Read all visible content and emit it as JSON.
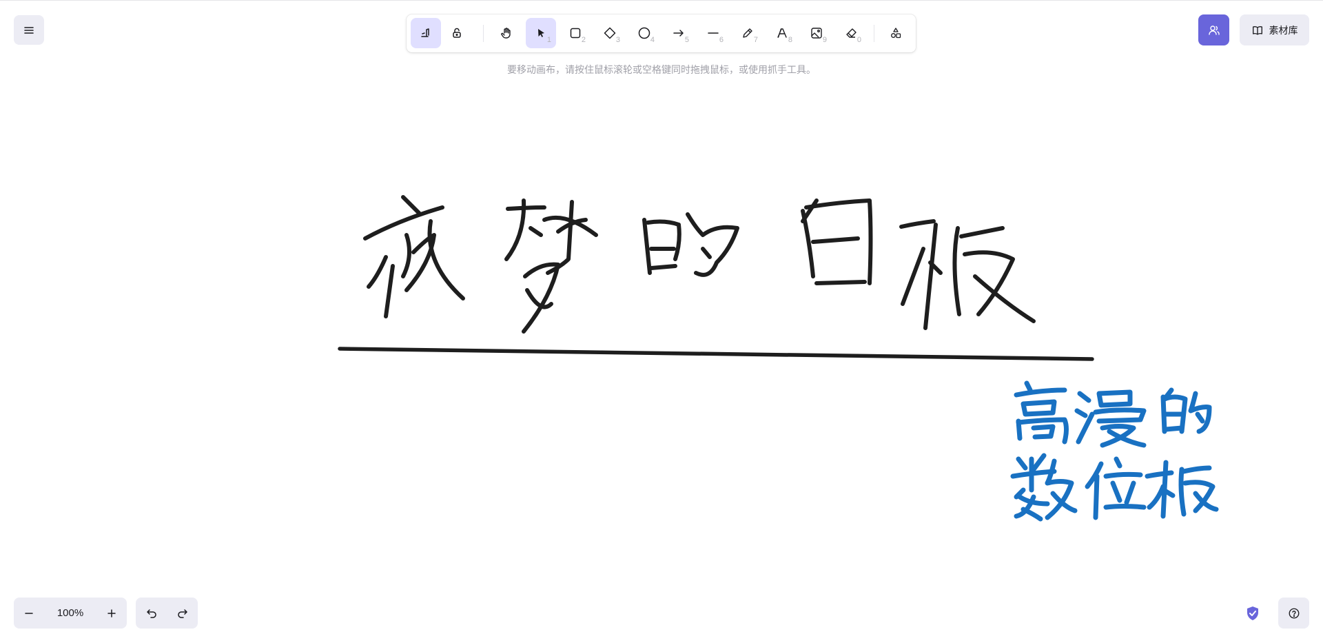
{
  "hint": "要移动画布，请按住鼠标滚轮或空格键同时拖拽鼠标，或使用抓手工具。",
  "toolbar": {
    "tools": [
      {
        "name": "pen-mode",
        "icon": "pen-mode-icon",
        "key": "",
        "active": true
      },
      {
        "name": "lock",
        "icon": "unlock-icon",
        "key": "",
        "active": false
      },
      {
        "name": "hand",
        "icon": "hand-icon",
        "key": "",
        "active": false
      },
      {
        "name": "selection",
        "icon": "pointer-icon",
        "key": "1",
        "active": true
      },
      {
        "name": "rectangle",
        "icon": "rectangle-icon",
        "key": "2",
        "active": false
      },
      {
        "name": "diamond",
        "icon": "diamond-icon",
        "key": "3",
        "active": false
      },
      {
        "name": "ellipse",
        "icon": "ellipse-icon",
        "key": "4",
        "active": false
      },
      {
        "name": "arrow",
        "icon": "arrow-icon",
        "key": "5",
        "active": false
      },
      {
        "name": "line",
        "icon": "line-icon",
        "key": "6",
        "active": false
      },
      {
        "name": "draw",
        "icon": "pencil-icon",
        "key": "7",
        "active": false
      },
      {
        "name": "text",
        "icon": "text-icon",
        "key": "8",
        "active": false
      },
      {
        "name": "image",
        "icon": "image-icon",
        "key": "9",
        "active": false
      },
      {
        "name": "eraser",
        "icon": "eraser-icon",
        "key": "0",
        "active": false
      },
      {
        "name": "more-shapes",
        "icon": "shapes-icon",
        "key": "",
        "active": false
      }
    ]
  },
  "library": {
    "label": "素材库"
  },
  "zoom": {
    "value": "100%"
  },
  "canvas": {
    "handwriting_black": "夜梦的白板",
    "handwriting_blue_line1": "高漫的",
    "handwriting_blue_line2": "数位板",
    "ink_black": "#1e1e1e",
    "ink_blue": "#1971c2"
  },
  "colors": {
    "accent": "#6965db",
    "island": "#ececf4",
    "active_tool": "#e0dfff"
  }
}
